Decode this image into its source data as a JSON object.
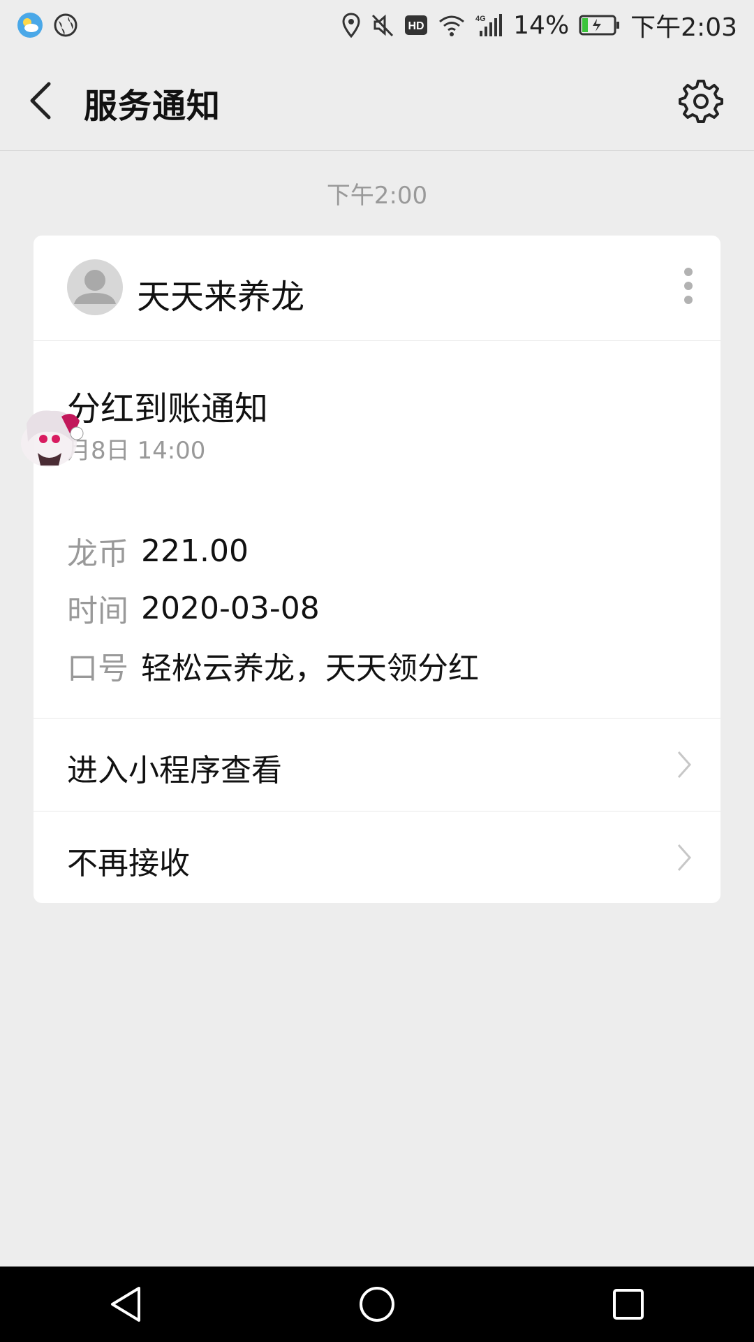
{
  "status_bar": {
    "battery_percent": "14%",
    "time": "下午2:03",
    "network": "4G"
  },
  "header": {
    "title": "服务通知"
  },
  "message_time": "下午2:00",
  "card": {
    "sender": "天天来养龙",
    "notice_title": "分红到账通知",
    "notice_date": "月8日  14:00",
    "fields": [
      {
        "label": "龙币",
        "value": "221.00"
      },
      {
        "label": "时间",
        "value": "2020-03-08"
      },
      {
        "label": "口号",
        "value": "轻松云养龙，天天领分红"
      }
    ],
    "actions": [
      {
        "label": "进入小程序查看"
      },
      {
        "label": "不再接收"
      }
    ]
  },
  "colors": {
    "background": "#ededed",
    "card": "#ffffff",
    "muted_text": "#999999",
    "nav_bar": "#000000"
  }
}
